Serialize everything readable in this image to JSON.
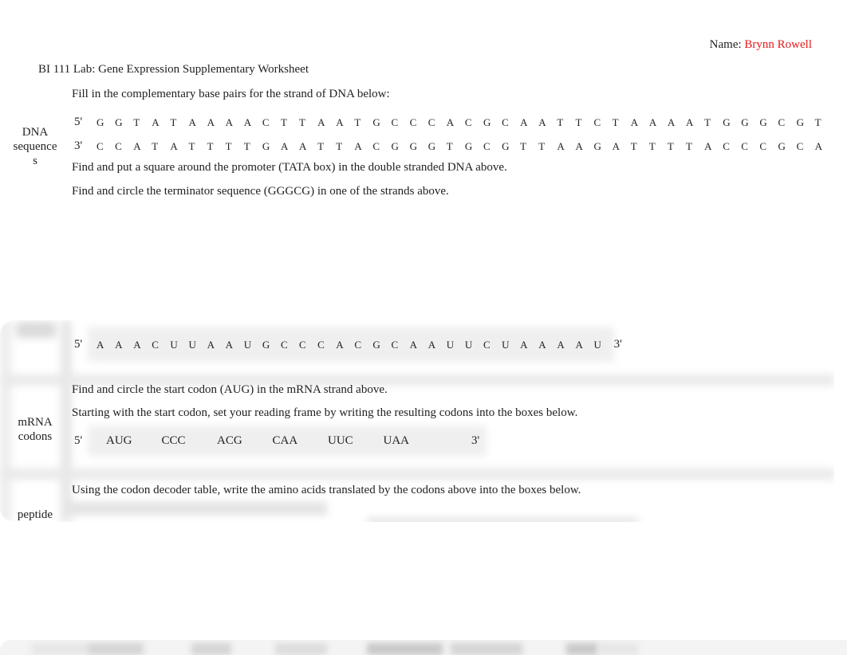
{
  "header": {
    "name_label": "Name:",
    "name_value": "Brynn Rowell",
    "title": "BI 111 Lab: Gene Expression Supplementary Worksheet"
  },
  "colors": {
    "answer_text": "#e8191c",
    "body_text": "#222222"
  },
  "dna_section": {
    "label_lines": [
      "DNA",
      "sequence",
      "s"
    ],
    "instruction": "Fill in the complementary base pairs for the strand of DNA below:",
    "top_strand": {
      "five_prime": "5'",
      "bases": [
        "G",
        "G",
        "T",
        "A",
        "T",
        "A",
        "A",
        "A",
        "A",
        "C",
        "T",
        "T",
        "A",
        "A",
        "T",
        "G",
        "C",
        "C",
        "C",
        "A",
        "C",
        "G",
        "C",
        "A",
        "A",
        "T",
        "T",
        "C",
        "T",
        "A",
        "A",
        "A",
        "A",
        "T",
        "G",
        "G",
        "G",
        "C",
        "G",
        "T"
      ]
    },
    "bottom_strand": {
      "three_prime": "3'",
      "bases": [
        "C",
        "C",
        "A",
        "T",
        "A",
        "T",
        "T",
        "T",
        "T",
        "G",
        "A",
        "A",
        "T",
        "T",
        "A",
        "C",
        "G",
        "G",
        "G",
        "T",
        "G",
        "C",
        "G",
        "T",
        "T",
        "A",
        "A",
        "G",
        "A",
        "T",
        "T",
        "T",
        "T",
        "A",
        "C",
        "C",
        "C",
        "G",
        "C",
        "A"
      ]
    },
    "promoter_instruction": "Find and put a square around the promoter (TATA box) in the double stranded DNA above.",
    "terminator_instruction": "Find and circle the terminator sequence (GGGCG) in one of the strands above."
  },
  "mrna_section": {
    "strand": {
      "five_prime": "5'",
      "three_prime": "3'",
      "bases": [
        "A",
        "A",
        "A",
        "C",
        "U",
        "U",
        "A",
        "A",
        "U",
        "G",
        "C",
        "C",
        "C",
        "A",
        "C",
        "G",
        "C",
        "A",
        "A",
        "U",
        "U",
        "C",
        "U",
        "A",
        "A",
        "A",
        "A",
        "U"
      ]
    },
    "label_lines": [
      "mRNA",
      "codons"
    ],
    "start_codon_instruction": "Find and circle the start codon (AUG) in the mRNA strand above.",
    "reading_frame_instruction": "Starting with the start codon, set your reading frame by writing the resulting codons into the boxes below.",
    "codons": {
      "five_prime": "5'",
      "three_prime": "3'",
      "values": [
        "AUG",
        "CCC",
        "ACG",
        "CAA",
        "UUC",
        "UAA"
      ]
    }
  },
  "peptide_section": {
    "label": "peptide",
    "instruction": "Using the codon decoder table, write the amino acids translated by the codons above into the boxes below."
  }
}
